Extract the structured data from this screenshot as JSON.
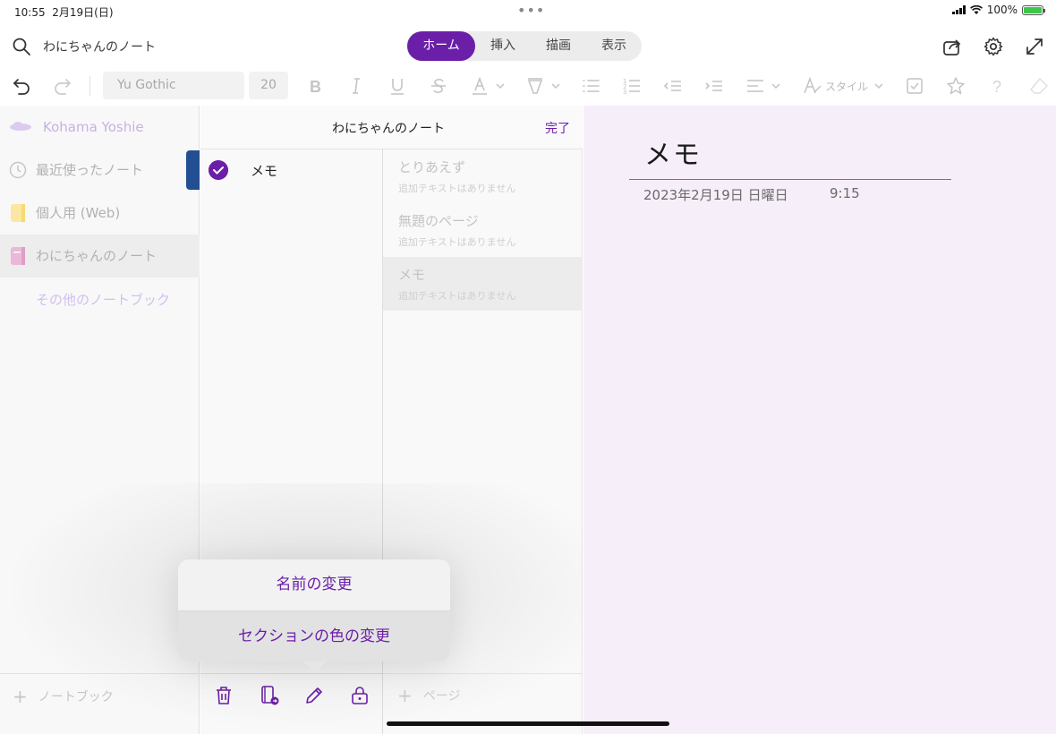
{
  "status_bar": {
    "time": "10:55",
    "date": "2月19日(日)",
    "battery": "100%"
  },
  "header": {
    "notebook_title": "わにちゃんのノート",
    "tabs": [
      {
        "label": "ホーム",
        "active": true
      },
      {
        "label": "挿入",
        "active": false
      },
      {
        "label": "描画",
        "active": false
      },
      {
        "label": "表示",
        "active": false
      }
    ]
  },
  "format_bar": {
    "font": "Yu Gothic",
    "size": "20",
    "style_label": "スタイル"
  },
  "sidebar": {
    "user": "Kohama Yoshie",
    "items": [
      {
        "label": "最近使ったノート",
        "icon": "clock-icon"
      },
      {
        "label": "個人用 (Web)",
        "icon": "notebook-yellow-icon"
      },
      {
        "label": "わにちゃんのノート",
        "icon": "notebook-pink-icon"
      }
    ],
    "other_notebooks": "その他のノートブック",
    "add_notebook": "ノートブック"
  },
  "sections_panel": {
    "title": "わにちゃんのノート",
    "done": "完了",
    "section": "メモ"
  },
  "pages": {
    "items": [
      {
        "title": "とりあえず",
        "subtitle": "追加テキストはありません"
      },
      {
        "title": "無題のページ",
        "subtitle": "追加テキストはありません"
      },
      {
        "title": "メモ",
        "subtitle": "追加テキストはありません"
      }
    ],
    "add_page": "ページ"
  },
  "popup": {
    "rename": "名前の変更",
    "change_color": "セクションの色の変更"
  },
  "note": {
    "title": "メモ",
    "date": "2023年2月19日 日曜日",
    "time": "9:15"
  },
  "colors": {
    "accent": "#6b1fa8",
    "canvas": "#f6eef8",
    "section_tab": "#214f92"
  }
}
